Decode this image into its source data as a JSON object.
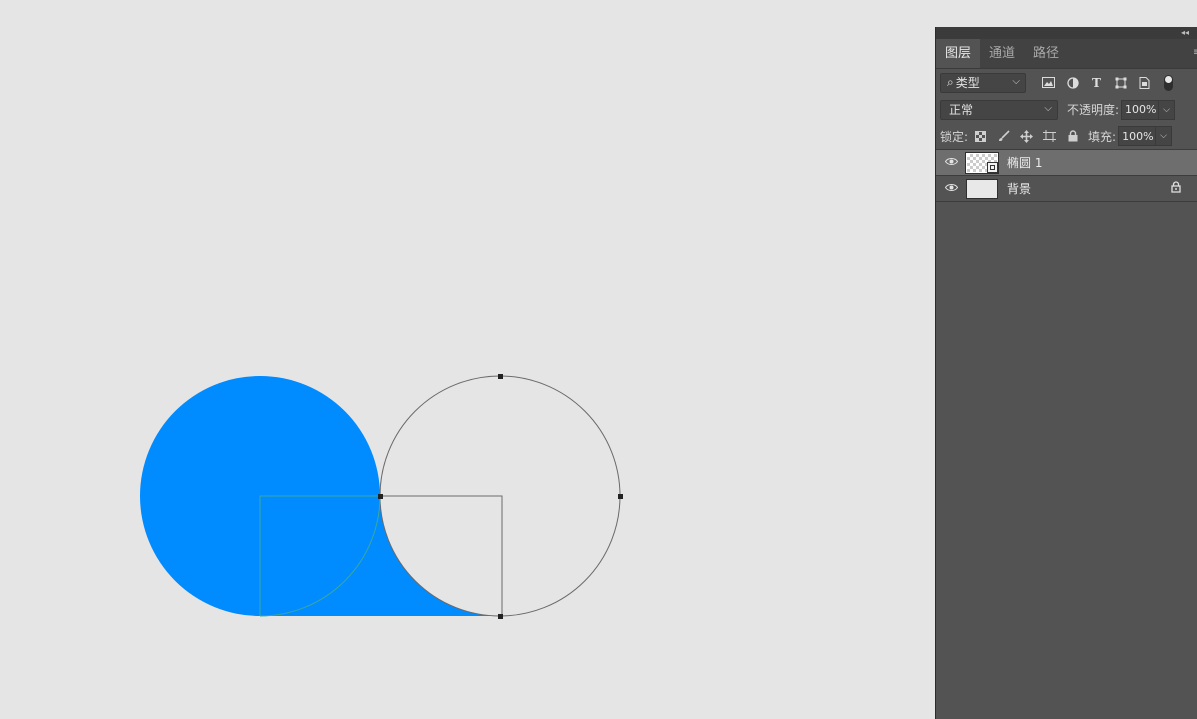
{
  "panel": {
    "tabs": [
      {
        "label": "图层",
        "active": true
      },
      {
        "label": "通道",
        "active": false
      },
      {
        "label": "路径",
        "active": false
      }
    ],
    "filter": {
      "kind_label": "类型",
      "icons": [
        "image-filter-icon",
        "adjustment-filter-icon",
        "type-filter-icon",
        "shape-filter-icon",
        "smart-object-filter-icon"
      ]
    },
    "blend": {
      "mode": "正常",
      "opacity_label": "不透明度:",
      "opacity_value": "100%"
    },
    "lock": {
      "label": "锁定:",
      "fill_label": "填充:",
      "fill_value": "100%"
    },
    "layers": [
      {
        "name": "椭圆 1",
        "selected": true,
        "visible": true,
        "thumb": "shape"
      },
      {
        "name": "背景",
        "selected": false,
        "visible": true,
        "thumb": "plain",
        "locked": true
      }
    ]
  },
  "colors": {
    "shape_fill": "#008bff",
    "canvas_bg": "#e5e5e5",
    "panel_bg": "#535353"
  }
}
